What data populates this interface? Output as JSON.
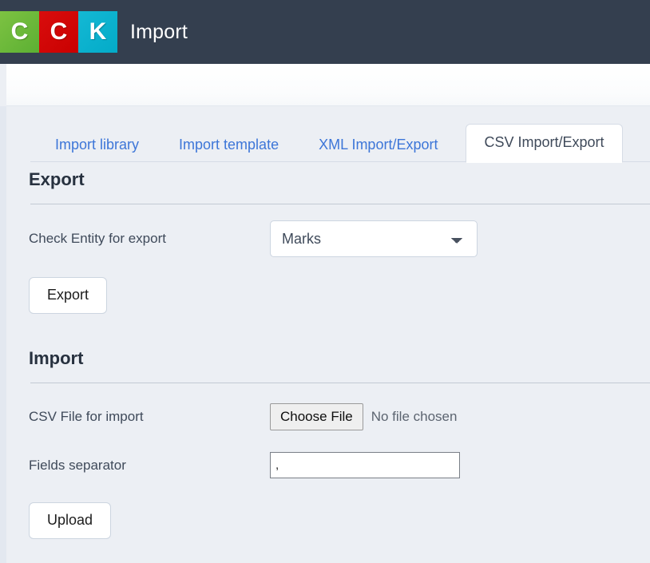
{
  "header": {
    "logo_tiles": [
      "C",
      "C",
      "K"
    ],
    "logo_colors": [
      "#5cb033",
      "#c90000",
      "#03abc8"
    ],
    "title": "Import"
  },
  "tabs": [
    {
      "label": "Import library",
      "active": false
    },
    {
      "label": "Import template",
      "active": false
    },
    {
      "label": "XML Import/Export",
      "active": false
    },
    {
      "label": "CSV Import/Export",
      "active": true
    }
  ],
  "export_section": {
    "heading": "Export",
    "entity_label": "Check Entity for export",
    "entity_value": "Marks",
    "entity_options": [
      "Marks"
    ],
    "export_button": "Export"
  },
  "import_section": {
    "heading": "Import",
    "file_label": "CSV File for import",
    "file_button": "Choose File",
    "file_status": "No file chosen",
    "separator_label": "Fields separator",
    "separator_value": ",",
    "upload_button": "Upload"
  },
  "colors": {
    "header_bg": "#343f4f",
    "page_bg": "#eceff4",
    "tab_link": "#3d76d8",
    "active_tab_text": "#3f4a5a",
    "heading": "#27313f"
  }
}
